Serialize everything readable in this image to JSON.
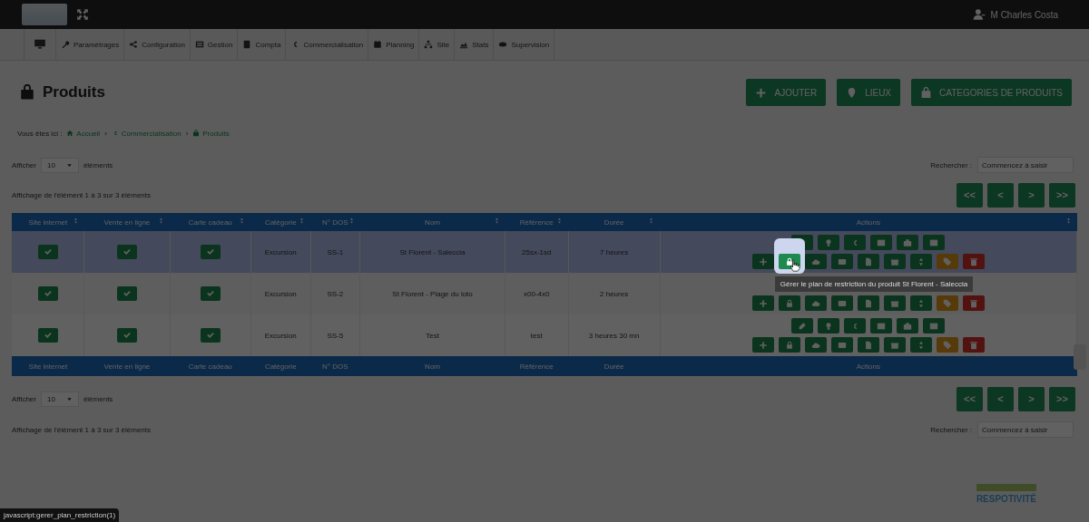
{
  "top_bar": {
    "user": "M Charles Costa"
  },
  "nav": [
    "Paramétrages",
    "Configuration",
    "Gestion",
    "Compta",
    "Commercialisation",
    "Planning",
    "Site",
    "Stats",
    "Supervision"
  ],
  "page": {
    "title": "Produits",
    "buttons": [
      "AJOUTER",
      "LIEUX",
      "CATEGORIES DE PRODUITS"
    ]
  },
  "breadcrumb": {
    "prefix": "Vous êtes ici :",
    "items": [
      {
        "label": "Accueil"
      },
      {
        "separator": "›",
        "label": "Commercialisation"
      },
      {
        "separator": "›",
        "label": "Produits"
      }
    ]
  },
  "length_top": {
    "before": "Afficher",
    "value": "10",
    "after": "éléments"
  },
  "info_top": "Affichage de l'élément 1 à 3 sur 3 éléments",
  "search_top": {
    "label": "Rechercher :",
    "placeholder": "Commencez à saisir"
  },
  "pagination": [
    "<<",
    "<",
    ">",
    ">>"
  ],
  "table": {
    "columns": [
      "Site internet",
      "Vente en ligne",
      "Carte cadeau",
      "Catégorie",
      "N° DOS",
      "Nom",
      "Référence",
      "Durée",
      "Actions"
    ],
    "footer": [
      "Site internet",
      "Vente en ligne",
      "Carte cadeau",
      "Catégorie",
      "N° DOS",
      "Nom",
      "Référence",
      "Durée",
      "Actions"
    ],
    "rows": [
      {
        "selected": true,
        "site": true,
        "online": true,
        "gift": true,
        "category": "Excursion",
        "number": "SS-1",
        "name": "St Florent - Saleccia",
        "reference": "25sx-1sd",
        "duration": "7 heures",
        "actions_top": [
          {
            "highlighted": false
          },
          {
            "highlighted": false
          },
          {
            "highlighted": false
          },
          {
            "highlighted": false
          },
          {
            "highlighted": false
          },
          {
            "highlighted": false
          }
        ],
        "actions_bottom": [
          {
            "highlighted": false
          },
          {
            "highlighted": true
          },
          {
            "highlighted": false
          },
          {
            "highlighted": false
          },
          {
            "highlighted": false
          },
          {
            "highlighted": false
          },
          {
            "highlighted": false
          },
          {
            "highlighted": false
          },
          {
            "highlighted": false
          }
        ]
      },
      {
        "selected": false,
        "site": true,
        "online": true,
        "gift": true,
        "category": "Excursion",
        "number": "SS-2",
        "name": "St Florent - Plage du loto",
        "reference": "x00-4x0",
        "duration": "2 heures",
        "actions_bottom": [
          {
            "highlighted": false
          },
          {
            "highlighted": false
          },
          {
            "highlighted": false
          },
          {
            "highlighted": false
          },
          {
            "highlighted": false
          },
          {
            "highlighted": false
          },
          {
            "highlighted": false
          },
          {
            "highlighted": false
          },
          {
            "highlighted": false
          }
        ]
      },
      {
        "selected": false,
        "site": true,
        "online": true,
        "gift": true,
        "category": "Excursion",
        "number": "SS-5",
        "name": "Test",
        "reference": "test",
        "duration": "3 heures 30 mn",
        "actions_top": [
          {
            "highlighted": false
          },
          {
            "highlighted": false
          },
          {
            "highlighted": false
          },
          {
            "highlighted": false
          },
          {
            "highlighted": false
          },
          {
            "highlighted": false
          }
        ],
        "actions_bottom": [
          {
            "highlighted": false
          },
          {
            "highlighted": false
          },
          {
            "highlighted": false
          },
          {
            "highlighted": false
          },
          {
            "highlighted": false
          },
          {
            "highlighted": false
          },
          {
            "highlighted": false
          },
          {
            "highlighted": false
          },
          {
            "highlighted": false
          }
        ]
      }
    ]
  },
  "tooltip": "Gérer le plan de restriction du produit St Florent - Saleccia",
  "length_bottom": {
    "before": "Afficher",
    "value": "10",
    "after": "éléments"
  },
  "search_bottom": {
    "label": "Rechercher :",
    "placeholder": "Commencez à saisir"
  },
  "info_bottom": "Affichage de l'élément 1 à 3 sur 3 éléments",
  "brand": "RESPOTIVITÉ",
  "status_bar": "javascript:gerer_plan_restriction(1)"
}
